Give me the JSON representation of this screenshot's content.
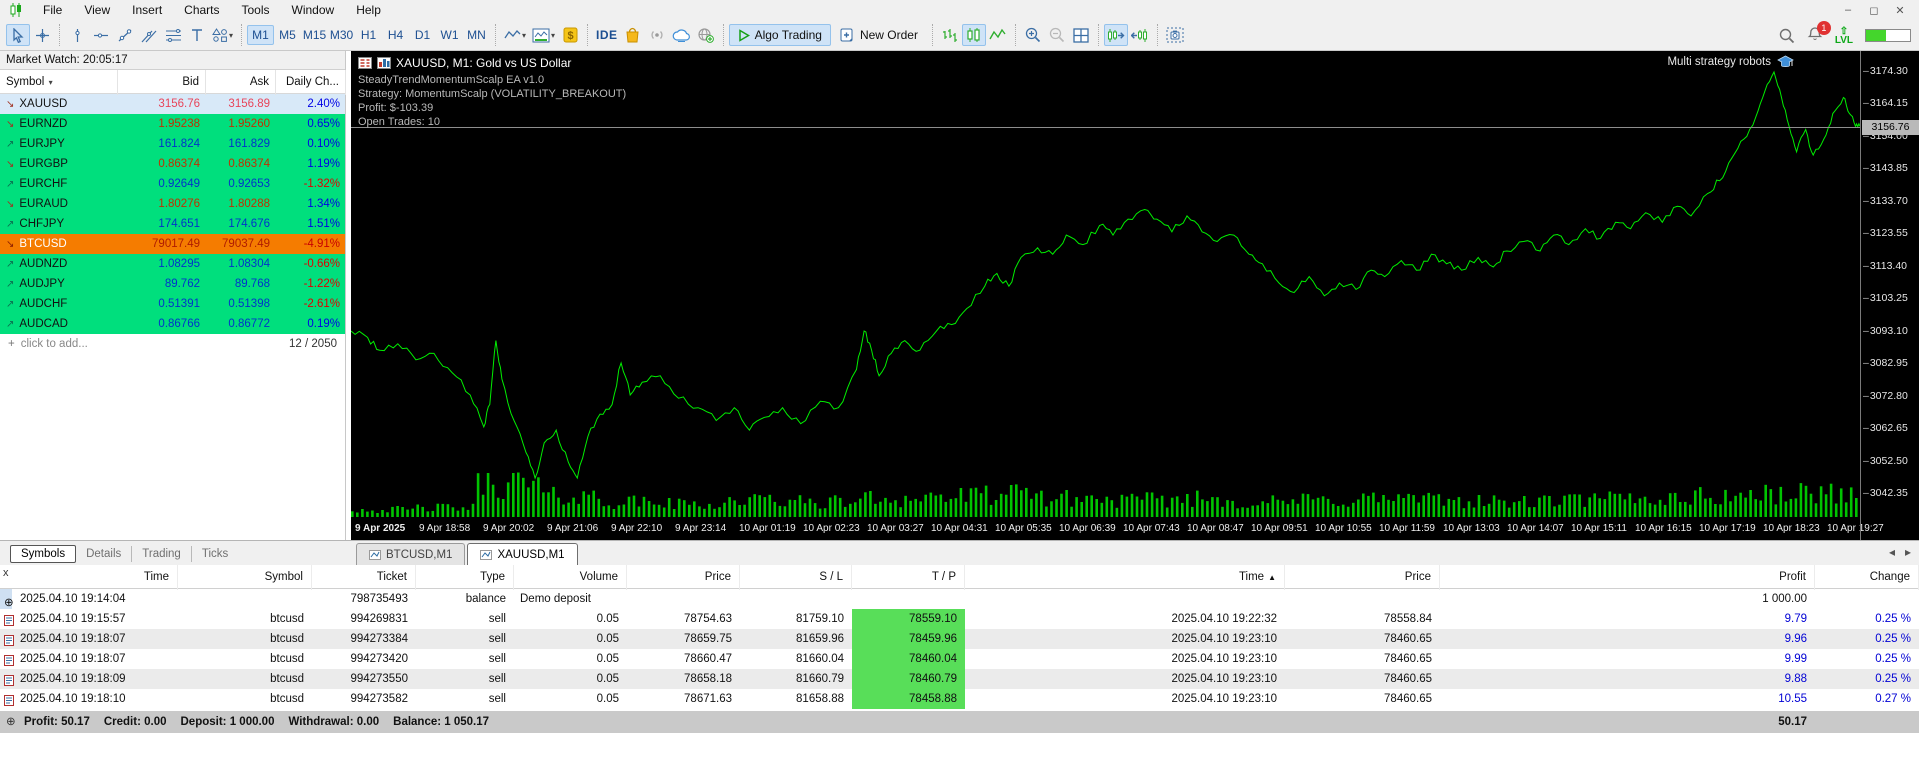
{
  "window": {
    "menus": [
      "File",
      "View",
      "Insert",
      "Charts",
      "Tools",
      "Window",
      "Help"
    ]
  },
  "toolbar": {
    "timeframes": [
      {
        "label": "M1",
        "active": true
      },
      {
        "label": "M5"
      },
      {
        "label": "M15"
      },
      {
        "label": "M30"
      },
      {
        "label": "H1"
      },
      {
        "label": "H4"
      },
      {
        "label": "D1"
      },
      {
        "label": "W1"
      },
      {
        "label": "MN"
      }
    ],
    "ide_label": "IDE",
    "algo_trading_label": "Algo Trading",
    "new_order_label": "New Order",
    "lvl_label": "LVL",
    "notification_count": "1"
  },
  "market_watch": {
    "title": "Market Watch: 20:05:17",
    "columns": {
      "symbol": "Symbol",
      "bid": "Bid",
      "ask": "Ask",
      "change": "Daily Ch..."
    },
    "rows": [
      {
        "symbol": "XAUUSD",
        "dir": "down",
        "bid": "3156.76",
        "ask": "3156.89",
        "change": "2.40%",
        "bg": "selected",
        "pc": "pink",
        "cc": "blue"
      },
      {
        "symbol": "EURNZD",
        "dir": "down",
        "bid": "1.95238",
        "ask": "1.95260",
        "change": "0.65%",
        "bg": "green",
        "pc": "red",
        "cc": "blue"
      },
      {
        "symbol": "EURJPY",
        "dir": "up",
        "bid": "161.824",
        "ask": "161.829",
        "change": "0.10%",
        "bg": "green",
        "pc": "blue",
        "cc": "blue"
      },
      {
        "symbol": "EURGBP",
        "dir": "down",
        "bid": "0.86374",
        "ask": "0.86374",
        "change": "1.19%",
        "bg": "green",
        "pc": "red",
        "cc": "blue"
      },
      {
        "symbol": "EURCHF",
        "dir": "up",
        "bid": "0.92649",
        "ask": "0.92653",
        "change": "-1.32%",
        "bg": "green",
        "pc": "blue",
        "cc": "red"
      },
      {
        "symbol": "EURAUD",
        "dir": "down",
        "bid": "1.80276",
        "ask": "1.80288",
        "change": "1.34%",
        "bg": "green",
        "pc": "red",
        "cc": "blue"
      },
      {
        "symbol": "CHFJPY",
        "dir": "up",
        "bid": "174.651",
        "ask": "174.676",
        "change": "1.51%",
        "bg": "green",
        "pc": "blue",
        "cc": "blue"
      },
      {
        "symbol": "BTCUSD",
        "dir": "down",
        "bid": "79017.49",
        "ask": "79037.49",
        "change": "-4.91%",
        "bg": "orange",
        "pc": "darkred",
        "cc": "red"
      },
      {
        "symbol": "AUDNZD",
        "dir": "up",
        "bid": "1.08295",
        "ask": "1.08304",
        "change": "-0.66%",
        "bg": "green",
        "pc": "blue",
        "cc": "red"
      },
      {
        "symbol": "AUDJPY",
        "dir": "up",
        "bid": "89.762",
        "ask": "89.768",
        "change": "-1.22%",
        "bg": "green",
        "pc": "blue",
        "cc": "red"
      },
      {
        "symbol": "AUDCHF",
        "dir": "up",
        "bid": "0.51391",
        "ask": "0.51398",
        "change": "-2.61%",
        "bg": "green",
        "pc": "blue",
        "cc": "red"
      },
      {
        "symbol": "AUDCAD",
        "dir": "up",
        "bid": "0.86766",
        "ask": "0.86772",
        "change": "0.19%",
        "bg": "green",
        "pc": "blue",
        "cc": "blue"
      }
    ],
    "add_row_label": "click to add...",
    "counter": "12 / 2050",
    "tabs": [
      {
        "label": "Symbols",
        "active": true
      },
      {
        "label": "Details"
      },
      {
        "label": "Trading"
      },
      {
        "label": "Ticks"
      }
    ]
  },
  "chart": {
    "title": "XAUUSD, M1:  Gold vs US Dollar",
    "overlay_lines": [
      {
        "text": "SteadyTrendMomentumScalp EA v1.0"
      },
      {
        "text": "Strategy: MomentumScalp (VOLATILITY_BREAKOUT)"
      },
      {
        "text": "Profit: $-103.39"
      },
      {
        "text": "Open Trades: 10"
      }
    ],
    "robot_label": "Multi strategy robots",
    "current_price": "3156.76",
    "price_labels": [
      {
        "v": "3174.30"
      },
      {
        "v": "3164.15"
      },
      {
        "v": "3154.00"
      },
      {
        "v": "3143.85"
      },
      {
        "v": "3133.70"
      },
      {
        "v": "3123.55"
      },
      {
        "v": "3113.40"
      },
      {
        "v": "3103.25"
      },
      {
        "v": "3093.10"
      },
      {
        "v": "3082.95"
      },
      {
        "v": "3072.80"
      },
      {
        "v": "3062.65"
      },
      {
        "v": "3052.50"
      },
      {
        "v": "3042.35"
      }
    ],
    "time_labels": [
      {
        "t": "9 Apr 2025"
      },
      {
        "t": "9 Apr 18:58"
      },
      {
        "t": "9 Apr 20:02"
      },
      {
        "t": "9 Apr 21:06"
      },
      {
        "t": "9 Apr 22:10"
      },
      {
        "t": "9 Apr 23:14"
      },
      {
        "t": "10 Apr 01:19"
      },
      {
        "t": "10 Apr 02:23"
      },
      {
        "t": "10 Apr 03:27"
      },
      {
        "t": "10 Apr 04:31"
      },
      {
        "t": "10 Apr 05:35"
      },
      {
        "t": "10 Apr 06:39"
      },
      {
        "t": "10 Apr 07:43"
      },
      {
        "t": "10 Apr 08:47"
      },
      {
        "t": "10 Apr 09:51"
      },
      {
        "t": "10 Apr 10:55"
      },
      {
        "t": "10 Apr 11:59"
      },
      {
        "t": "10 Apr 13:03"
      },
      {
        "t": "10 Apr 14:07"
      },
      {
        "t": "10 Apr 15:11"
      },
      {
        "t": "10 Apr 16:15"
      },
      {
        "t": "10 Apr 17:19"
      },
      {
        "t": "10 Apr 18:23"
      },
      {
        "t": "10 Apr 19:27"
      }
    ],
    "tabs": [
      {
        "label": "BTCUSD,M1"
      },
      {
        "label": "XAUUSD,M1",
        "active": true
      }
    ]
  },
  "chart_data": {
    "type": "line",
    "symbol": "XAUUSD",
    "timeframe": "M1",
    "title": "XAUUSD, M1: Gold vs US Dollar",
    "ylim": [
      3037,
      3179
    ],
    "current_price": 3156.76,
    "x_range": [
      "9 Apr 2025 18:00",
      "10 Apr 2025 19:27"
    ],
    "points": [
      [
        0,
        3093
      ],
      [
        0.011,
        3091
      ],
      [
        0.019,
        3087
      ],
      [
        0.031,
        3089
      ],
      [
        0.043,
        3084
      ],
      [
        0.055,
        3086
      ],
      [
        0.067,
        3080
      ],
      [
        0.079,
        3073
      ],
      [
        0.088,
        3063
      ],
      [
        0.092,
        3070
      ],
      [
        0.096,
        3090
      ],
      [
        0.1,
        3078
      ],
      [
        0.108,
        3065
      ],
      [
        0.116,
        3055
      ],
      [
        0.122,
        3047
      ],
      [
        0.128,
        3058
      ],
      [
        0.136,
        3062
      ],
      [
        0.144,
        3052
      ],
      [
        0.15,
        3047
      ],
      [
        0.157,
        3060
      ],
      [
        0.165,
        3067
      ],
      [
        0.173,
        3070
      ],
      [
        0.179,
        3083
      ],
      [
        0.185,
        3073
      ],
      [
        0.193,
        3077
      ],
      [
        0.205,
        3079
      ],
      [
        0.217,
        3072
      ],
      [
        0.23,
        3069
      ],
      [
        0.242,
        3065
      ],
      [
        0.254,
        3069
      ],
      [
        0.264,
        3062
      ],
      [
        0.274,
        3066
      ],
      [
        0.286,
        3069
      ],
      [
        0.298,
        3064
      ],
      [
        0.311,
        3071
      ],
      [
        0.323,
        3069
      ],
      [
        0.335,
        3081
      ],
      [
        0.34,
        3093
      ],
      [
        0.345,
        3087
      ],
      [
        0.35,
        3079
      ],
      [
        0.358,
        3086
      ],
      [
        0.367,
        3090
      ],
      [
        0.377,
        3087
      ],
      [
        0.388,
        3093
      ],
      [
        0.398,
        3095
      ],
      [
        0.408,
        3100
      ],
      [
        0.42,
        3107
      ],
      [
        0.428,
        3111
      ],
      [
        0.436,
        3107
      ],
      [
        0.444,
        3116
      ],
      [
        0.455,
        3119
      ],
      [
        0.465,
        3117
      ],
      [
        0.474,
        3123
      ],
      [
        0.485,
        3120
      ],
      [
        0.496,
        3126
      ],
      [
        0.505,
        3123
      ],
      [
        0.515,
        3128
      ],
      [
        0.526,
        3131
      ],
      [
        0.534,
        3128
      ],
      [
        0.544,
        3124
      ],
      [
        0.554,
        3129
      ],
      [
        0.564,
        3124
      ],
      [
        0.574,
        3121
      ],
      [
        0.585,
        3123
      ],
      [
        0.595,
        3117
      ],
      [
        0.604,
        3114
      ],
      [
        0.615,
        3108
      ],
      [
        0.625,
        3105
      ],
      [
        0.635,
        3110
      ],
      [
        0.645,
        3104
      ],
      [
        0.655,
        3108
      ],
      [
        0.666,
        3106
      ],
      [
        0.676,
        3112
      ],
      [
        0.685,
        3110
      ],
      [
        0.696,
        3115
      ],
      [
        0.706,
        3112
      ],
      [
        0.716,
        3117
      ],
      [
        0.726,
        3114
      ],
      [
        0.736,
        3112
      ],
      [
        0.747,
        3116
      ],
      [
        0.757,
        3113
      ],
      [
        0.766,
        3118
      ],
      [
        0.777,
        3121
      ],
      [
        0.788,
        3118
      ],
      [
        0.797,
        3123
      ],
      [
        0.807,
        3120
      ],
      [
        0.818,
        3125
      ],
      [
        0.828,
        3122
      ],
      [
        0.838,
        3127
      ],
      [
        0.848,
        3125
      ],
      [
        0.858,
        3130
      ],
      [
        0.869,
        3127
      ],
      [
        0.879,
        3132
      ],
      [
        0.888,
        3129
      ],
      [
        0.899,
        3136
      ],
      [
        0.907,
        3140
      ],
      [
        0.915,
        3147
      ],
      [
        0.923,
        3153
      ],
      [
        0.931,
        3160
      ],
      [
        0.937,
        3168
      ],
      [
        0.943,
        3174
      ],
      [
        0.948,
        3166
      ],
      [
        0.953,
        3157
      ],
      [
        0.958,
        3149
      ],
      [
        0.964,
        3156
      ],
      [
        0.969,
        3148
      ],
      [
        0.976,
        3153
      ],
      [
        0.982,
        3161
      ],
      [
        0.989,
        3166
      ],
      [
        0.993,
        3161
      ],
      [
        0.997,
        3157
      ],
      [
        1,
        3157
      ]
    ],
    "volume_profile": [
      0.2,
      0.25,
      0.9,
      0.55,
      0.4,
      0.35,
      0.45,
      0.4,
      0.5,
      0.55,
      0.6,
      0.5,
      0.45,
      0.5,
      0.4,
      0.45,
      0.5,
      0.45,
      0.4,
      0.45,
      0.5,
      0.55,
      0.6,
      0.65
    ]
  },
  "toolbox": {
    "columns": [
      {
        "label": "Time"
      },
      {
        "label": "Symbol"
      },
      {
        "label": "Ticket"
      },
      {
        "label": "Type"
      },
      {
        "label": "Volume"
      },
      {
        "label": "Price"
      },
      {
        "label": "S / L"
      },
      {
        "label": "T / P"
      },
      {
        "label": "Time",
        "sorted": true
      },
      {
        "label": "Price"
      },
      {
        "label": "Profit"
      },
      {
        "label": "Change"
      }
    ],
    "balance_row": {
      "time": "2025.04.10 19:14:04",
      "ticket": "798735493",
      "type": "balance",
      "comment": "Demo deposit",
      "profit": "1 000.00"
    },
    "trades": [
      {
        "time": "2025.04.10 19:15:57",
        "symbol": "btcusd",
        "ticket": "994269831",
        "type": "sell",
        "volume": "0.05",
        "price": "78754.63",
        "sl": "81759.10",
        "tp": "78559.10",
        "close_time": "2025.04.10 19:22:32",
        "close_price": "78558.84",
        "profit": "9.79",
        "change": "0.25 %"
      },
      {
        "time": "2025.04.10 19:18:07",
        "symbol": "btcusd",
        "ticket": "994273384",
        "type": "sell",
        "volume": "0.05",
        "price": "78659.75",
        "sl": "81659.96",
        "tp": "78459.96",
        "close_time": "2025.04.10 19:23:10",
        "close_price": "78460.65",
        "profit": "9.96",
        "change": "0.25 %"
      },
      {
        "time": "2025.04.10 19:18:07",
        "symbol": "btcusd",
        "ticket": "994273420",
        "type": "sell",
        "volume": "0.05",
        "price": "78660.47",
        "sl": "81660.04",
        "tp": "78460.04",
        "close_time": "2025.04.10 19:23:10",
        "close_price": "78460.65",
        "profit": "9.99",
        "change": "0.25 %"
      },
      {
        "time": "2025.04.10 19:18:09",
        "symbol": "btcusd",
        "ticket": "994273550",
        "type": "sell",
        "volume": "0.05",
        "price": "78658.18",
        "sl": "81660.79",
        "tp": "78460.79",
        "close_time": "2025.04.10 19:23:10",
        "close_price": "78460.65",
        "profit": "9.88",
        "change": "0.25 %"
      },
      {
        "time": "2025.04.10 19:18:10",
        "symbol": "btcusd",
        "ticket": "994273582",
        "type": "sell",
        "volume": "0.05",
        "price": "78671.63",
        "sl": "81658.88",
        "tp": "78458.88",
        "close_time": "2025.04.10 19:23:10",
        "close_price": "78460.65",
        "profit": "10.55",
        "change": "0.27 %"
      }
    ],
    "summary": {
      "pairs": [
        [
          "Profit:",
          "50.17"
        ],
        [
          "Credit:",
          "0.00"
        ],
        [
          "Deposit:",
          "1 000.00"
        ],
        [
          "Withdrawal:",
          "0.00"
        ],
        [
          "Balance:",
          "1 050.17"
        ]
      ],
      "total": "50.17"
    }
  }
}
